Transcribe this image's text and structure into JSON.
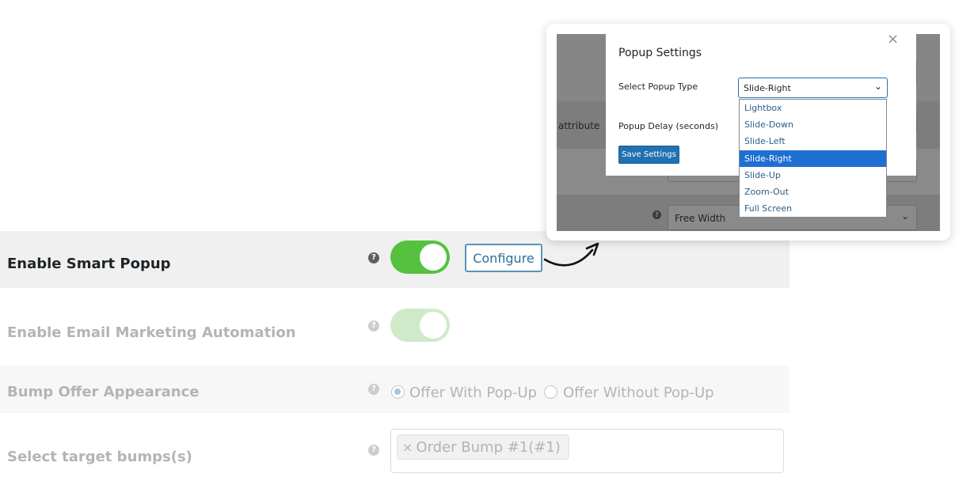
{
  "settings": {
    "smart_popup": {
      "label": "Enable Smart Popup",
      "help": "?",
      "enabled": true,
      "configure_label": "Configure"
    },
    "email_automation": {
      "label": "Enable Email Marketing Automation",
      "help": "?",
      "enabled": true
    },
    "bump_appearance": {
      "label": "Bump Offer Appearance",
      "help": "?",
      "options": [
        "Offer With Pop-Up",
        "Offer Without Pop-Up"
      ],
      "selected": "Offer With Pop-Up"
    },
    "target_bumps": {
      "label": "Select target bumps(s)",
      "help": "?",
      "chips": [
        {
          "remove": "×",
          "label": "Order Bump #1(#1)"
        }
      ]
    }
  },
  "popup_modal": {
    "title": "Popup Settings",
    "close_symbol": "×",
    "type_label": "Select Popup Type",
    "type_value": "Slide-Right",
    "type_options": [
      "Lightbox",
      "Slide-Down",
      "Slide-Left",
      "Slide-Right",
      "Slide-Up",
      "Zoom-Out",
      "Full Screen"
    ],
    "delay_label": "Popup Delay (seconds)",
    "save_label": "Save Settings"
  },
  "background_panel": {
    "attribute_text": "attribute",
    "width_value": "Free Width",
    "help": "?"
  },
  "colors": {
    "toggle_on": "#54c23e",
    "accent_blue": "#2271b1",
    "selected_option": "#1e6fd1"
  },
  "icons": [
    "help-icon",
    "close-icon",
    "chevron-down-icon",
    "curved-arrow-icon"
  ]
}
